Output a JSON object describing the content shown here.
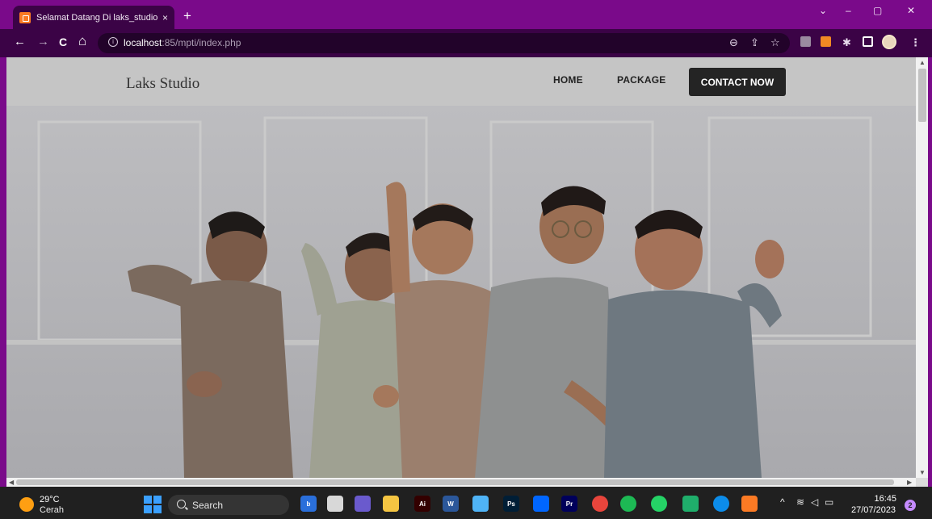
{
  "browser": {
    "tab_title": "Selamat Datang Di laks_studio",
    "tab_close": "×",
    "new_tab": "+",
    "url_host": "localhost",
    "url_rest": ":85/mpti/index.php",
    "back": "←",
    "forward": "→",
    "reload": "C",
    "home": "⌂",
    "minimize": "–",
    "restore": "▢",
    "close": "✕",
    "tab_search": "⌄"
  },
  "site": {
    "brand": "Laks Studio",
    "nav": {
      "home": "HOME",
      "package": "PACKAGE",
      "cta": "CONTACT NOW"
    }
  },
  "taskbar": {
    "weather_temp": "29°C",
    "weather_cond": "Cerah",
    "search_label": "Search",
    "time": "16:45",
    "date": "27/07/2023",
    "notifications": "2",
    "apps": [
      {
        "icon": "bing-icon",
        "label": "b",
        "color": "#2a6fdb"
      },
      {
        "icon": "file-explorer-icon",
        "label": "",
        "color": "#d8d8d8"
      },
      {
        "icon": "teams-icon",
        "label": "",
        "color": "#6a5acd"
      },
      {
        "icon": "folder-icon",
        "label": "",
        "color": "#f5c542"
      },
      {
        "icon": "illustrator-icon",
        "label": "Ai",
        "color": "#330000"
      },
      {
        "icon": "word-icon",
        "label": "W",
        "color": "#2b579a"
      },
      {
        "icon": "notepad-icon",
        "label": "",
        "color": "#4fb3f6"
      },
      {
        "icon": "photoshop-icon",
        "label": "Ps",
        "color": "#001e36"
      },
      {
        "icon": "power-automate-icon",
        "label": "",
        "color": "#0066ff"
      },
      {
        "icon": "premiere-icon",
        "label": "Pr",
        "color": "#00005b"
      },
      {
        "icon": "chrome-icon",
        "label": "",
        "color": "#e8453c"
      },
      {
        "icon": "spotify-icon",
        "label": "",
        "color": "#1db954"
      },
      {
        "icon": "whatsapp-icon",
        "label": "",
        "color": "#25d366"
      },
      {
        "icon": "app-green-icon",
        "label": "",
        "color": "#1fae6b"
      },
      {
        "icon": "edge-icon",
        "label": "",
        "color": "#0c8ce9"
      },
      {
        "icon": "xampp-icon",
        "label": "",
        "color": "#fb7a24"
      }
    ]
  }
}
